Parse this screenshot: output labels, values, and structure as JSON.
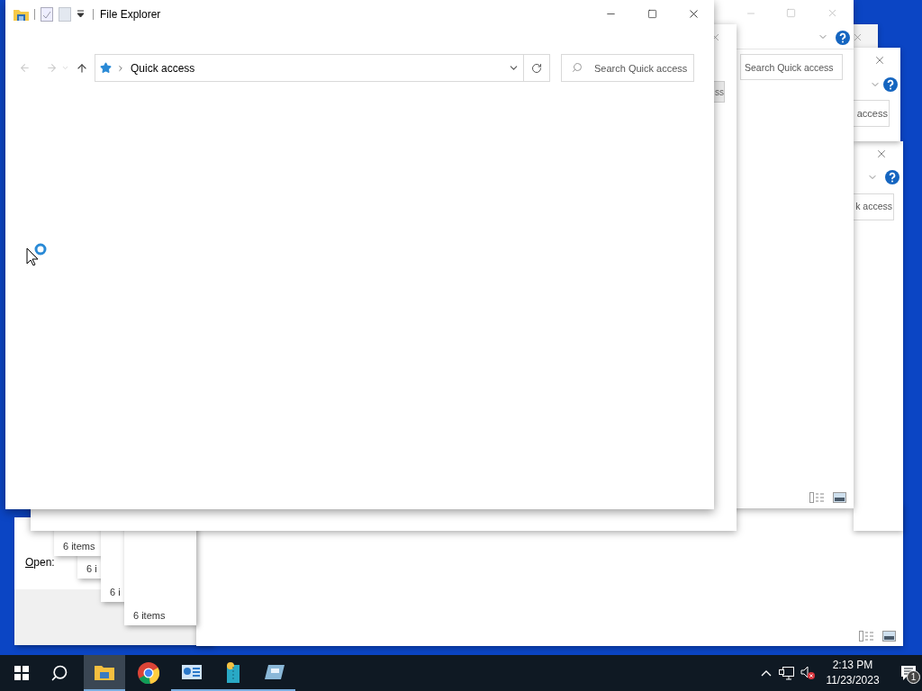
{
  "main_window": {
    "title": "File Explorer",
    "address": "Quick access",
    "search_placeholder": "Search Quick access"
  },
  "window_b": {
    "search_placeholder": "Search Quick access"
  },
  "window_c": {
    "search_text": "ss"
  },
  "window_d": {
    "search_text": "access"
  },
  "window_e": {
    "search_text": "k access"
  },
  "status_windows": [
    {
      "status": "6 items"
    },
    {
      "status": "6 i"
    },
    {
      "status": "6 i"
    },
    {
      "status": "6 items"
    }
  ],
  "run_dialog": {
    "label": "Open:"
  },
  "taskbar": {
    "time": "2:13 PM",
    "date": "11/23/2023",
    "notification_count": "1"
  }
}
